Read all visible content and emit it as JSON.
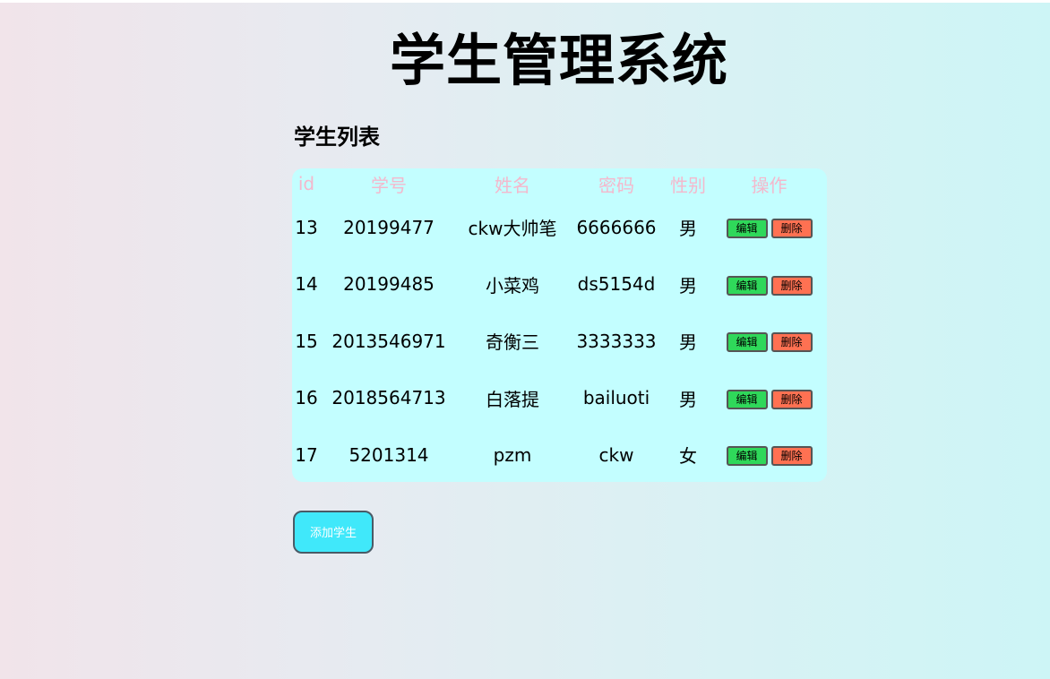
{
  "page_title": "学生管理系统",
  "list_title": "学生列表",
  "table": {
    "headers": [
      "id",
      "学号",
      "姓名",
      "密码",
      "性别",
      "操作"
    ],
    "rows": [
      {
        "id": "13",
        "xh": "20199477",
        "name": "ckw大帅笔",
        "pwd": "6666666",
        "sex": "男"
      },
      {
        "id": "14",
        "xh": "20199485",
        "name": "小菜鸡",
        "pwd": "ds5154d",
        "sex": "男"
      },
      {
        "id": "15",
        "xh": "2013546971",
        "name": "奇衡三",
        "pwd": "3333333",
        "sex": "男"
      },
      {
        "id": "16",
        "xh": "2018564713",
        "name": "白落提",
        "pwd": "bailuoti",
        "sex": "男"
      },
      {
        "id": "17",
        "xh": "5201314",
        "name": "pzm",
        "pwd": "ckw",
        "sex": "女"
      }
    ],
    "edit_label": "编辑",
    "delete_label": "删除"
  },
  "add_button_label": "添加学生",
  "colors": {
    "table_bg": "#c3feff",
    "header_text": "#f4b8cc",
    "edit_button": "#2fd85a",
    "delete_button": "#ff7152",
    "add_button": "#40e8fa"
  }
}
